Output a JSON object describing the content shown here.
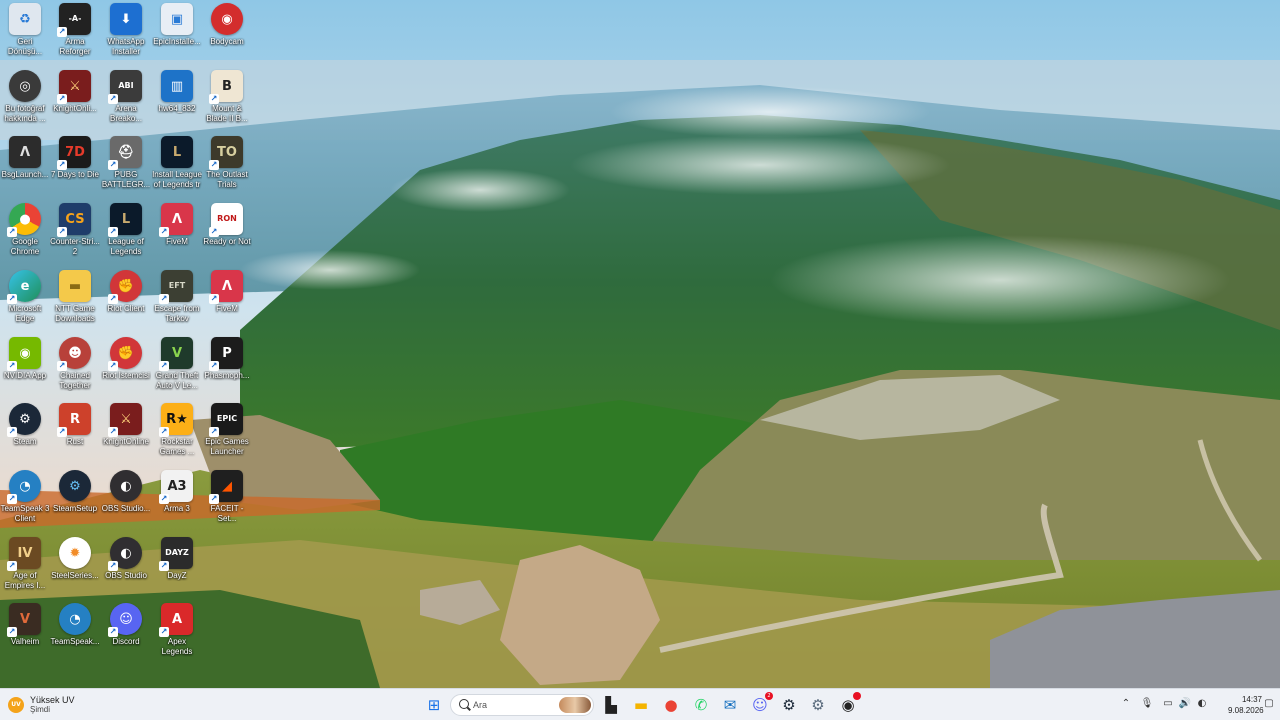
{
  "desktop": {
    "icons": [
      {
        "label": "Geri Dönüşü...",
        "icon": "recycle-bin-icon",
        "bg": "#dfe7ef",
        "fg": "#2a7bd6",
        "glyph": "♻",
        "shortcut": false,
        "col": 0,
        "row": 0
      },
      {
        "label": "Arma Reforger",
        "icon": "arma-reforger-icon",
        "bg": "#222222",
        "fg": "#ffffff",
        "glyph": "-A-",
        "shortcut": true,
        "col": 1,
        "row": 0
      },
      {
        "label": "WhatsApp Installer",
        "icon": "download-icon",
        "bg": "#1d6fd1",
        "fg": "#ffffff",
        "glyph": "⬇",
        "shortcut": false,
        "col": 2,
        "row": 0
      },
      {
        "label": "EpicInstalle...",
        "icon": "installer-icon",
        "bg": "#e8eef5",
        "fg": "#2a7bd6",
        "glyph": "▣",
        "shortcut": false,
        "col": 3,
        "row": 0
      },
      {
        "label": "Bodycam",
        "icon": "bodycam-icon",
        "bg": "#d32d2d",
        "fg": "#ffffff",
        "glyph": "◉",
        "shortcut": false,
        "round": true,
        "col": 4,
        "row": 0
      },
      {
        "label": "Bu fotoğraf hakkında ...",
        "icon": "camera-info-icon",
        "bg": "#3a3a3a",
        "fg": "#ffffff",
        "glyph": "◎",
        "shortcut": false,
        "round": true,
        "col": 0,
        "row": 1
      },
      {
        "label": "KnightOnli...",
        "icon": "knightonline-icon",
        "bg": "#7a1d1d",
        "fg": "#ffd27a",
        "glyph": "⚔",
        "shortcut": true,
        "col": 1,
        "row": 1
      },
      {
        "label": "Arena Breako...",
        "icon": "arena-breakout-icon",
        "bg": "#3b3b3b",
        "fg": "#ffffff",
        "glyph": "ABI",
        "shortcut": true,
        "col": 2,
        "row": 1
      },
      {
        "label": "hw64_832",
        "icon": "hwinfo-icon",
        "bg": "#1e73c8",
        "fg": "#ffffff",
        "glyph": "▥",
        "shortcut": false,
        "col": 3,
        "row": 1
      },
      {
        "label": "Mount & Blade II B...",
        "icon": "bannerlord-icon",
        "bg": "#efe6d3",
        "fg": "#222222",
        "glyph": "B",
        "shortcut": true,
        "col": 4,
        "row": 1
      },
      {
        "label": "BsgLaunch...",
        "icon": "bsg-launcher-icon",
        "bg": "#2c2c2c",
        "fg": "#e0e0e0",
        "glyph": "Λ",
        "shortcut": false,
        "col": 0,
        "row": 2
      },
      {
        "label": "7 Days to Die",
        "icon": "7days-icon",
        "bg": "#1b1b1b",
        "fg": "#e63b2b",
        "glyph": "7D",
        "shortcut": true,
        "col": 1,
        "row": 2
      },
      {
        "label": "PUBG BATTLEGR...",
        "icon": "pubg-icon",
        "bg": "#6a6a6a",
        "fg": "#ffffff",
        "glyph": "⛑",
        "shortcut": true,
        "col": 2,
        "row": 2
      },
      {
        "label": "Install League of Legends tr",
        "icon": "league-installer-icon",
        "bg": "#0b1a2a",
        "fg": "#c8aa6e",
        "glyph": "L",
        "shortcut": false,
        "col": 3,
        "row": 2
      },
      {
        "label": "The Outlast Trials",
        "icon": "outlast-trials-icon",
        "bg": "#3d3a2b",
        "fg": "#d8d0a0",
        "glyph": "TO",
        "shortcut": true,
        "col": 4,
        "row": 2
      },
      {
        "label": "Google Chrome",
        "icon": "chrome-icon",
        "bg": "conic-gradient(#ea4335 0 33%,#fbbc05 0 66%,#34a853 0)",
        "fg": "#ffffff",
        "glyph": "●",
        "shortcut": true,
        "round": true,
        "col": 0,
        "row": 3
      },
      {
        "label": "Counter-Stri... 2",
        "icon": "cs2-icon",
        "bg": "#1f3d6a",
        "fg": "#f6a31a",
        "glyph": "CS",
        "shortcut": true,
        "col": 1,
        "row": 3
      },
      {
        "label": "League of Legends",
        "icon": "league-icon",
        "bg": "#0b1a2a",
        "fg": "#c8aa6e",
        "glyph": "L",
        "shortcut": true,
        "col": 2,
        "row": 3
      },
      {
        "label": "FiveM",
        "icon": "fivem-icon",
        "bg": "#d9364a",
        "fg": "#ffffff",
        "glyph": "Λ",
        "shortcut": true,
        "col": 3,
        "row": 3
      },
      {
        "label": "Ready or Not",
        "icon": "ready-or-not-icon",
        "bg": "#ffffff",
        "fg": "#c01818",
        "glyph": "RON",
        "shortcut": true,
        "col": 4,
        "row": 3
      },
      {
        "label": "Microsoft Edge",
        "icon": "edge-icon",
        "bg": "linear-gradient(135deg,#36c2e8,#1f8f5a)",
        "fg": "#ffffff",
        "glyph": "e",
        "shortcut": true,
        "round": true,
        "col": 0,
        "row": 4
      },
      {
        "label": "NTT Game Downloads",
        "icon": "folder-icon",
        "bg": "#f4c94a",
        "fg": "#8a6b14",
        "glyph": "▬",
        "shortcut": false,
        "col": 1,
        "row": 4
      },
      {
        "label": "Riot Client",
        "icon": "riot-client-icon",
        "bg": "#d13639",
        "fg": "#ffffff",
        "glyph": "✊",
        "shortcut": true,
        "round": true,
        "col": 2,
        "row": 4
      },
      {
        "label": "Escape from Tarkov",
        "icon": "tarkov-icon",
        "bg": "#3c3f33",
        "fg": "#d8d8c8",
        "glyph": "EFT",
        "shortcut": true,
        "col": 3,
        "row": 4
      },
      {
        "label": "FiveM",
        "icon": "fivem-icon",
        "bg": "#d9364a",
        "fg": "#ffffff",
        "glyph": "Λ",
        "shortcut": true,
        "col": 4,
        "row": 4
      },
      {
        "label": "NVIDIA App",
        "icon": "nvidia-icon",
        "bg": "#76b900",
        "fg": "#ffffff",
        "glyph": "◉",
        "shortcut": true,
        "col": 0,
        "row": 5
      },
      {
        "label": "Chained Together",
        "icon": "chained-together-icon",
        "bg": "#b8413a",
        "fg": "#ffffff",
        "glyph": "☻",
        "shortcut": true,
        "round": true,
        "col": 1,
        "row": 5
      },
      {
        "label": "Riot İstemcisi",
        "icon": "riot-client-tr-icon",
        "bg": "#d13639",
        "fg": "#ffffff",
        "glyph": "✊",
        "shortcut": true,
        "round": true,
        "col": 2,
        "row": 5
      },
      {
        "label": "Grand Theft Auto V Le...",
        "icon": "gta5-icon",
        "bg": "#1f3a2b",
        "fg": "#8bd44e",
        "glyph": "V",
        "shortcut": true,
        "col": 3,
        "row": 5
      },
      {
        "label": "Phasmoph...",
        "icon": "phasmophobia-icon",
        "bg": "#1c1c1c",
        "fg": "#ffffff",
        "glyph": "P",
        "shortcut": true,
        "col": 4,
        "row": 5
      },
      {
        "label": "Steam",
        "icon": "steam-icon",
        "bg": "#1b2838",
        "fg": "#ffffff",
        "glyph": "⚙",
        "shortcut": true,
        "round": true,
        "col": 0,
        "row": 6
      },
      {
        "label": "Rust",
        "icon": "rust-icon",
        "bg": "#cd412b",
        "fg": "#ffffff",
        "glyph": "R",
        "shortcut": true,
        "col": 1,
        "row": 6
      },
      {
        "label": "KnightOnline",
        "icon": "knightonline-alt-icon",
        "bg": "#7a1d1d",
        "fg": "#ffd27a",
        "glyph": "⚔",
        "shortcut": true,
        "col": 2,
        "row": 6
      },
      {
        "label": "Rockstar Games ...",
        "icon": "rockstar-icon",
        "bg": "#fcaf17",
        "fg": "#111111",
        "glyph": "R★",
        "shortcut": true,
        "col": 3,
        "row": 6
      },
      {
        "label": "Epic Games Launcher",
        "icon": "epic-games-icon",
        "bg": "#1a1a1a",
        "fg": "#ffffff",
        "glyph": "EPIC",
        "shortcut": true,
        "col": 4,
        "row": 6
      },
      {
        "label": "TeamSpeak 3 Client",
        "icon": "teamspeak3-icon",
        "bg": "#2580c3",
        "fg": "#ffffff",
        "glyph": "◔",
        "shortcut": true,
        "round": true,
        "col": 0,
        "row": 7
      },
      {
        "label": "SteamSetup",
        "icon": "steam-setup-icon",
        "bg": "#1b2838",
        "fg": "#66c0f4",
        "glyph": "⚙",
        "shortcut": false,
        "round": true,
        "col": 1,
        "row": 7
      },
      {
        "label": "OBS Studio...",
        "icon": "obs-setup-icon",
        "bg": "#302e31",
        "fg": "#ffffff",
        "glyph": "◐",
        "shortcut": false,
        "round": true,
        "col": 2,
        "row": 7
      },
      {
        "label": "Arma 3",
        "icon": "arma3-icon",
        "bg": "#f2f2f2",
        "fg": "#222222",
        "glyph": "A3",
        "shortcut": true,
        "col": 3,
        "row": 7
      },
      {
        "label": "FACEIT - Set...",
        "icon": "faceit-icon",
        "bg": "#1f1f1f",
        "fg": "#ff5500",
        "glyph": "◢",
        "shortcut": true,
        "col": 4,
        "row": 7
      },
      {
        "label": "Age of Empires I...",
        "icon": "aoe-icon",
        "bg": "#6b4a22",
        "fg": "#f2d08a",
        "glyph": "IV",
        "shortcut": true,
        "col": 0,
        "row": 8
      },
      {
        "label": "SteelSeries...",
        "icon": "steelseries-icon",
        "bg": "#ffffff",
        "fg": "#f28c28",
        "glyph": "✹",
        "shortcut": false,
        "round": true,
        "col": 1,
        "row": 8
      },
      {
        "label": "OBS Studio",
        "icon": "obs-icon",
        "bg": "#302e31",
        "fg": "#ffffff",
        "glyph": "◐",
        "shortcut": true,
        "round": true,
        "col": 2,
        "row": 8
      },
      {
        "label": "DayZ",
        "icon": "dayz-icon",
        "bg": "#2b2b2b",
        "fg": "#ffffff",
        "glyph": "DAYZ",
        "shortcut": true,
        "col": 3,
        "row": 8
      },
      {
        "label": "Valheim",
        "icon": "valheim-icon",
        "bg": "#3a2c22",
        "fg": "#e06a3a",
        "glyph": "V",
        "shortcut": true,
        "col": 0,
        "row": 9
      },
      {
        "label": "TeamSpeak...",
        "icon": "teamspeak-icon",
        "bg": "#2580c3",
        "fg": "#ffffff",
        "glyph": "◔",
        "shortcut": false,
        "round": true,
        "col": 1,
        "row": 9
      },
      {
        "label": "Discord",
        "icon": "discord-icon",
        "bg": "#5865f2",
        "fg": "#ffffff",
        "glyph": "☺",
        "shortcut": true,
        "round": true,
        "col": 2,
        "row": 9
      },
      {
        "label": "Apex Legends",
        "icon": "apex-icon",
        "bg": "#da292a",
        "fg": "#ffffff",
        "glyph": "A",
        "shortcut": true,
        "col": 3,
        "row": 9
      }
    ]
  },
  "taskbar": {
    "weather": {
      "title": "Yüksek UV",
      "subtitle": "Şimdi",
      "badge": "UV"
    },
    "search": {
      "placeholder": "Ara"
    },
    "apps": [
      {
        "name": "start-button",
        "icon": "windows-start-icon",
        "glyph": "⊞",
        "color": "#1a73e8"
      },
      {
        "name": "task-view-button",
        "icon": "task-view-icon",
        "glyph": "▙",
        "color": "#222222"
      },
      {
        "name": "file-explorer-button",
        "icon": "file-explorer-icon",
        "glyph": "▬",
        "color": "#f4b400"
      },
      {
        "name": "chrome-button",
        "icon": "chrome-icon",
        "glyph": "●",
        "color": "#ea4335"
      },
      {
        "name": "whatsapp-button",
        "icon": "whatsapp-icon",
        "glyph": "✆",
        "color": "#25d366"
      },
      {
        "name": "outlook-button",
        "icon": "outlook-icon",
        "glyph": "✉",
        "color": "#0f6cbd"
      },
      {
        "name": "discord-button",
        "icon": "discord-icon",
        "glyph": "☺",
        "color": "#5865f2",
        "badge": "2"
      },
      {
        "name": "steam-button",
        "icon": "steam-icon",
        "glyph": "⚙",
        "color": "#1b2838"
      },
      {
        "name": "settings-button",
        "icon": "settings-gear-icon",
        "glyph": "⚙",
        "color": "#5a6b7d"
      },
      {
        "name": "game-app-button",
        "icon": "game-app-icon",
        "glyph": "◉",
        "color": "#222222",
        "badge": ""
      }
    ],
    "tray": [
      {
        "name": "show-hidden-icons-button",
        "icon": "chevron-up-icon",
        "glyph": "⌃"
      },
      {
        "name": "microphone-button",
        "icon": "microphone-icon",
        "glyph": "🎙"
      },
      {
        "name": "network-button",
        "icon": "network-icon",
        "glyph": "▭"
      },
      {
        "name": "volume-button",
        "icon": "volume-icon",
        "glyph": "🔊"
      },
      {
        "name": "battery-status-button",
        "icon": "battery-icon",
        "glyph": "◐"
      }
    ],
    "clock": {
      "time": "14:37",
      "date": "9.08.2026"
    },
    "notification": {
      "icon": "notification-bell-icon",
      "glyph": "▢"
    }
  }
}
